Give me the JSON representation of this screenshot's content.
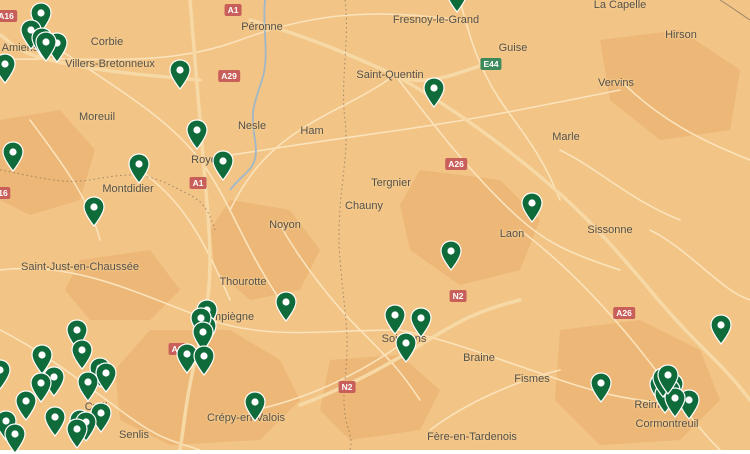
{
  "map": {
    "colors": {
      "land": "#f2c486",
      "terrain": "#e8ad6b",
      "roads": "#fbe3bb",
      "motorway": "#f7d9a6",
      "river": "#9fb7c9",
      "border": "#7c6c5c",
      "pin_fill": "#0f6b3a",
      "pin_dot": "#ffffff"
    },
    "places": [
      {
        "name": "Amiens"
      },
      {
        "name": "Corbie"
      },
      {
        "name": "Villers-Bretonneux"
      },
      {
        "name": "Péronne"
      },
      {
        "name": "Fresnoy-le-Grand"
      },
      {
        "name": "La Capelle"
      },
      {
        "name": "Guise"
      },
      {
        "name": "Hirson"
      },
      {
        "name": "Saint-Quentin"
      },
      {
        "name": "Vervins"
      },
      {
        "name": "Moreuil"
      },
      {
        "name": "Nesle"
      },
      {
        "name": "Ham"
      },
      {
        "name": "Marle"
      },
      {
        "name": "Roye"
      },
      {
        "name": "Montdidier"
      },
      {
        "name": "Tergnier"
      },
      {
        "name": "Chauny"
      },
      {
        "name": "Noyon"
      },
      {
        "name": "Laon"
      },
      {
        "name": "Sissonne"
      },
      {
        "name": "Saint-Just-en-Chaussée"
      },
      {
        "name": "Thourotte"
      },
      {
        "name": "Compiègne"
      },
      {
        "name": "Soissons"
      },
      {
        "name": "Braine"
      },
      {
        "name": "Fismes"
      },
      {
        "name": "Reims"
      },
      {
        "name": "Cormontreuil"
      },
      {
        "name": "Crépy-en-Valois"
      },
      {
        "name": "Senlis"
      },
      {
        "name": "Creil"
      },
      {
        "name": "Fère-en-Tardenois"
      }
    ],
    "road_badges": [
      {
        "label": "A1",
        "kind": "red"
      },
      {
        "label": "A16",
        "kind": "red"
      },
      {
        "label": "A29",
        "kind": "red"
      },
      {
        "label": "A1",
        "kind": "red"
      },
      {
        "label": "A26",
        "kind": "red"
      },
      {
        "label": "E44",
        "kind": "green"
      },
      {
        "label": "N2",
        "kind": "red"
      },
      {
        "label": "A26",
        "kind": "red"
      },
      {
        "label": "A1",
        "kind": "red"
      },
      {
        "label": "N2",
        "kind": "red"
      },
      {
        "label": "16",
        "kind": "red"
      }
    ],
    "pin_count": 55
  }
}
